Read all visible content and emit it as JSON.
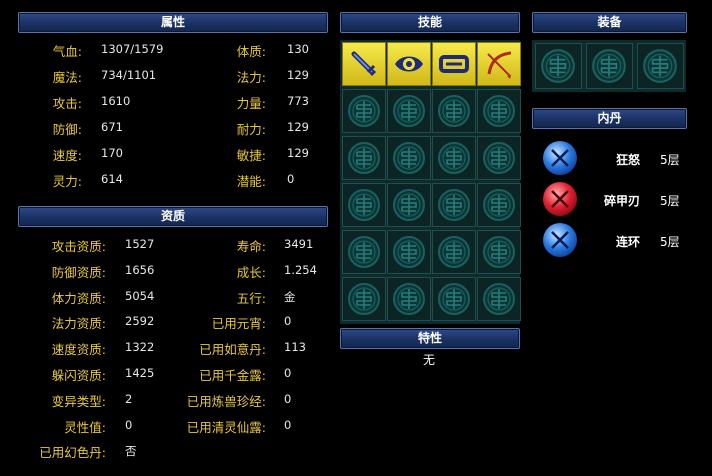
{
  "attributes": {
    "title": "属性",
    "left": [
      {
        "label": "气血:",
        "value": "1307/1579"
      },
      {
        "label": "魔法:",
        "value": "734/1101"
      },
      {
        "label": "攻击:",
        "value": "1610"
      },
      {
        "label": "防御:",
        "value": "671"
      },
      {
        "label": "速度:",
        "value": "170"
      },
      {
        "label": "灵力:",
        "value": "614"
      }
    ],
    "right": [
      {
        "label": "体质:",
        "value": "130"
      },
      {
        "label": "法力:",
        "value": "129"
      },
      {
        "label": "力量:",
        "value": "773"
      },
      {
        "label": "耐力:",
        "value": "129"
      },
      {
        "label": "敏捷:",
        "value": "129"
      },
      {
        "label": "潜能:",
        "value": "0"
      }
    ]
  },
  "aptitude": {
    "title": "资质",
    "left": [
      {
        "label": "攻击资质:",
        "value": "1527"
      },
      {
        "label": "防御资质:",
        "value": "1656"
      },
      {
        "label": "体力资质:",
        "value": "5054"
      },
      {
        "label": "法力资质:",
        "value": "2592"
      },
      {
        "label": "速度资质:",
        "value": "1322"
      },
      {
        "label": "躲闪资质:",
        "value": "1425"
      },
      {
        "label": "变异类型:",
        "value": "2"
      },
      {
        "label": "灵性值:",
        "value": "0"
      },
      {
        "label": "已用幻色丹:",
        "value": "否"
      }
    ],
    "right": [
      {
        "label": "寿命:",
        "value": "3491"
      },
      {
        "label": "成长:",
        "value": "1.254"
      },
      {
        "label": "五行:",
        "value": "金"
      },
      {
        "label": "已用元宵:",
        "value": "0"
      },
      {
        "label": "已用如意丹:",
        "value": "113"
      },
      {
        "label": "已用千金露:",
        "value": "0"
      },
      {
        "label": "已用炼兽珍经:",
        "value": "0"
      },
      {
        "label": "已用清灵仙露:",
        "value": "0"
      }
    ]
  },
  "skills": {
    "title": "技能",
    "learned": [
      {
        "icon": "sword-skill-icon"
      },
      {
        "icon": "eye-skill-icon"
      },
      {
        "icon": "shield-skill-icon"
      },
      {
        "icon": "bow-skill-icon"
      }
    ],
    "rows": 6,
    "cols": 4
  },
  "trait": {
    "title": "特性",
    "value": "无"
  },
  "equipment": {
    "title": "装备",
    "slots": 3
  },
  "inner_pill": {
    "title": "内丹",
    "items": [
      {
        "name": "狂怒",
        "level": "5层",
        "color": "blue"
      },
      {
        "name": "碎甲刃",
        "level": "5层",
        "color": "red"
      },
      {
        "name": "连环",
        "level": "5层",
        "color": "blue"
      }
    ]
  }
}
